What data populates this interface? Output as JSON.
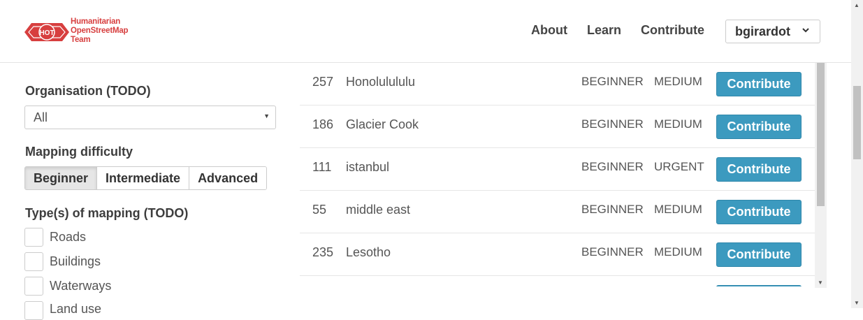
{
  "header": {
    "logo_badge": "HOT",
    "logo_line1": "Humanitarian",
    "logo_line2": "OpenStreetMap",
    "logo_line3": "Team",
    "nav_about": "About",
    "nav_learn": "Learn",
    "nav_contribute": "Contribute",
    "user": "bgirardot",
    "brand_color": "#d73f3f"
  },
  "filters": {
    "organisation_label": "Organisation (TODO)",
    "organisation_value": "All",
    "difficulty_label": "Mapping difficulty",
    "difficulty_options": [
      "Beginner",
      "Intermediate",
      "Advanced"
    ],
    "difficulty_selected": "Beginner",
    "types_label": "Type(s) of mapping (TODO)",
    "types": [
      "Roads",
      "Buildings",
      "Waterways",
      "Land use"
    ]
  },
  "projects": [
    {
      "id": "257",
      "name": "Honolulululu",
      "level": "BEGINNER",
      "priority": "MEDIUM",
      "action": "Contribute"
    },
    {
      "id": "186",
      "name": "Glacier Cook",
      "level": "BEGINNER",
      "priority": "MEDIUM",
      "action": "Contribute"
    },
    {
      "id": "111",
      "name": "istanbul",
      "level": "BEGINNER",
      "priority": "URGENT",
      "action": "Contribute"
    },
    {
      "id": "55",
      "name": "middle east",
      "level": "BEGINNER",
      "priority": "MEDIUM",
      "action": "Contribute"
    },
    {
      "id": "235",
      "name": "Lesotho",
      "level": "BEGINNER",
      "priority": "MEDIUM",
      "action": "Contribute"
    }
  ],
  "colors": {
    "accent": "#3c9abf"
  }
}
